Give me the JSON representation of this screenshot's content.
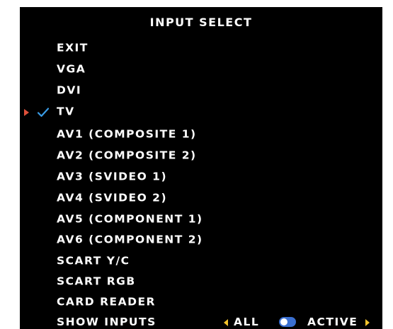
{
  "menu": {
    "title": "INPUT SELECT",
    "items": [
      {
        "label": "EXIT"
      },
      {
        "label": "VGA"
      },
      {
        "label": "DVI"
      },
      {
        "label": "TV",
        "selected": true
      },
      {
        "label": "AV1 (COMPOSITE 1)"
      },
      {
        "label": "AV2 (COMPOSITE 2)"
      },
      {
        "label": "AV3 (SVIDEO 1)"
      },
      {
        "label": "AV4 (SVIDEO 2)"
      },
      {
        "label": "AV5 (COMPONENT 1)"
      },
      {
        "label": "AV6 (COMPONENT 2)"
      },
      {
        "label": "SCART Y/C"
      },
      {
        "label": "SCART RGB"
      },
      {
        "label": "CARD READER"
      }
    ],
    "show_inputs": {
      "label": "SHOW INPUTS",
      "option_left": "ALL",
      "option_right": "ACTIVE",
      "state": "ACTIVE"
    }
  },
  "colors": {
    "background": "#000000",
    "text": "#ffffff",
    "pointer": "#e0503a",
    "checkmark": "#3a9ce6",
    "arrows": "#f2c22b",
    "toggle": "#3a6fd0"
  },
  "icons": {
    "pointer": "triangle-right-icon",
    "selected": "checkmark-icon",
    "scroll_left": "triangle-left-icon",
    "scroll_right": "triangle-right-icon",
    "switch": "toggle-switch-icon"
  }
}
